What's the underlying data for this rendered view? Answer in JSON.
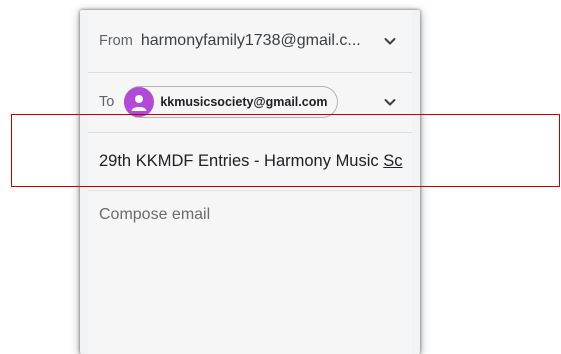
{
  "email": {
    "from_label": "From",
    "from_value": "harmonyfamily1738@gmail.c...",
    "to_label": "To",
    "to_recipient": "kkmusicsociety@gmail.com",
    "subject_main": "29th KKMDF Entries - Harmony Music ",
    "subject_tail": "Sc",
    "compose_placeholder": "Compose email"
  },
  "icons": {
    "from_expand": "chevron-down-icon",
    "to_expand": "chevron-down-icon",
    "recipient_avatar": "person-icon"
  },
  "colors": {
    "avatar": "#b04ad7",
    "highlight": "#c00000"
  }
}
